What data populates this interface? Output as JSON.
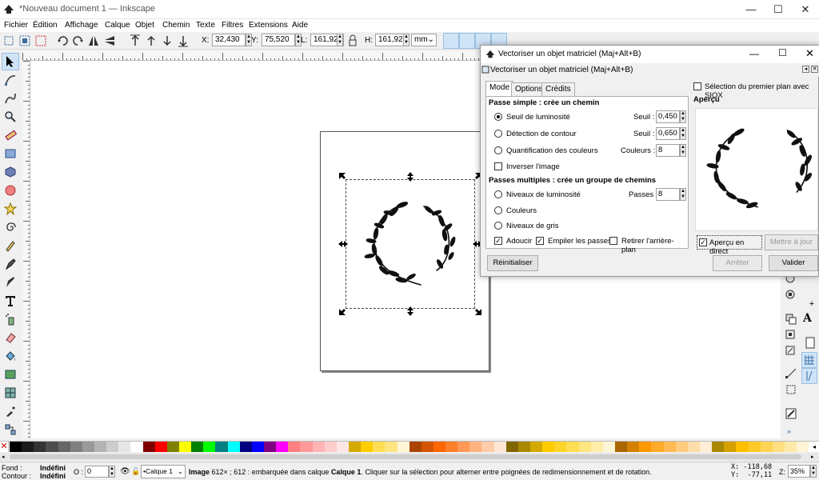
{
  "window": {
    "title": "*Nouveau document 1 — Inkscape"
  },
  "menu": [
    "Fichier",
    "Édition",
    "Affichage",
    "Calque",
    "Objet",
    "Chemin",
    "Texte",
    "Filtres",
    "Extensions",
    "Aide"
  ],
  "toolbar": {
    "x_label": "X:",
    "x_value": "32,430",
    "y_label": "Y:",
    "y_value": "75,520",
    "w_label": "L:",
    "w_value": "161,925",
    "h_label": "H:",
    "h_value": "161,925",
    "unit": "mm"
  },
  "dialog": {
    "title": "Vectoriser un objet matriciel (Maj+Alt+B)",
    "subtitle": "Vectoriser un objet matriciel (Maj+Alt+B)",
    "tabs": [
      "Mode",
      "Options",
      "Crédits"
    ],
    "single_pass_heading": "Passe simple : crée un chemin",
    "opt_brightness": "Seuil de luminosité",
    "opt_brightness_field": "Seuil :",
    "opt_brightness_value": "0,450",
    "opt_edge": "Détection de contour",
    "opt_edge_field": "Seuil :",
    "opt_edge_value": "0,650",
    "opt_quant": "Quantification des couleurs",
    "opt_quant_field": "Couleurs :",
    "opt_quant_value": "8",
    "opt_invert": "Inverser l'image",
    "multi_pass_heading": "Passes multiples : crée un groupe de chemins",
    "opt_bright_steps": "Niveaux de luminosité",
    "opt_bright_steps_field": "Passes :",
    "opt_bright_steps_value": "8",
    "opt_colors": "Couleurs",
    "opt_grays": "Niveaux de gris",
    "opt_smooth": "Adoucir",
    "opt_stack": "Empiler les passes",
    "opt_remove_bg": "Retirer l'arrière-plan",
    "sioxy": "Sélection du premier plan avec SIOX",
    "preview_label": "Aperçu",
    "live_preview": "Aperçu en direct",
    "update_btn": "Mettre à jour",
    "reset_btn": "Réinitialiser",
    "stop_btn": "Arrêter",
    "ok_btn": "Valider"
  },
  "status": {
    "fill_label": "Fond :",
    "fill_value": "Indéfini",
    "stroke_label": "Contour :",
    "stroke_value": "Indéfini",
    "opacity_label": "O :",
    "opacity_value": "0",
    "layer": "•Calque 1",
    "message_bold": "Image",
    "message": " 612× ; 612 : embarquée dans calque ",
    "message_layer": "Calque 1",
    "message_tail": ". Cliquer sur la sélection pour alterner entre poignées de redimensionnement et de rotation.",
    "x_coord": "X: -118,68",
    "y_coord": "Y:  -77,11",
    "zoom_label": "Z:",
    "zoom_value": "35%"
  },
  "colors": {
    "accent": "#cfe4f7",
    "palette": [
      "#000000",
      "#1a1a1a",
      "#333333",
      "#4d4d4d",
      "#666666",
      "#808080",
      "#999999",
      "#b3b3b3",
      "#cccccc",
      "#e6e6e6",
      "#ffffff",
      "#800000",
      "#ff0000",
      "#808000",
      "#ffff00",
      "#008000",
      "#00ff00",
      "#008080",
      "#00ffff",
      "#000080",
      "#0000ff",
      "#800080",
      "#ff00ff",
      "#ff8080",
      "#ff9999",
      "#ffb3b3",
      "#ffcccc",
      "#ffe6e6",
      "#d4aa00",
      "#ffcc00",
      "#ffdd55",
      "#ffe680",
      "#fff6d5",
      "#aa4400",
      "#d45500",
      "#ff6600",
      "#ff7f2a",
      "#ff9955",
      "#ffb380",
      "#ffccaa",
      "#ffe6d5",
      "#806600",
      "#aa8800",
      "#d4aa00",
      "#ffcc00",
      "#ffd42a",
      "#ffdd55",
      "#ffe680",
      "#ffeeaa",
      "#fff6d5",
      "#aa6600",
      "#d48000",
      "#ff9900",
      "#ffaa2a",
      "#ffb955",
      "#ffcc80",
      "#ffddaa",
      "#ffeed5",
      "#aa8800",
      "#d4a000",
      "#ffbf00",
      "#ffc92a",
      "#ffd355",
      "#ffdf80",
      "#ffe9aa",
      "#fff4d5"
    ]
  }
}
